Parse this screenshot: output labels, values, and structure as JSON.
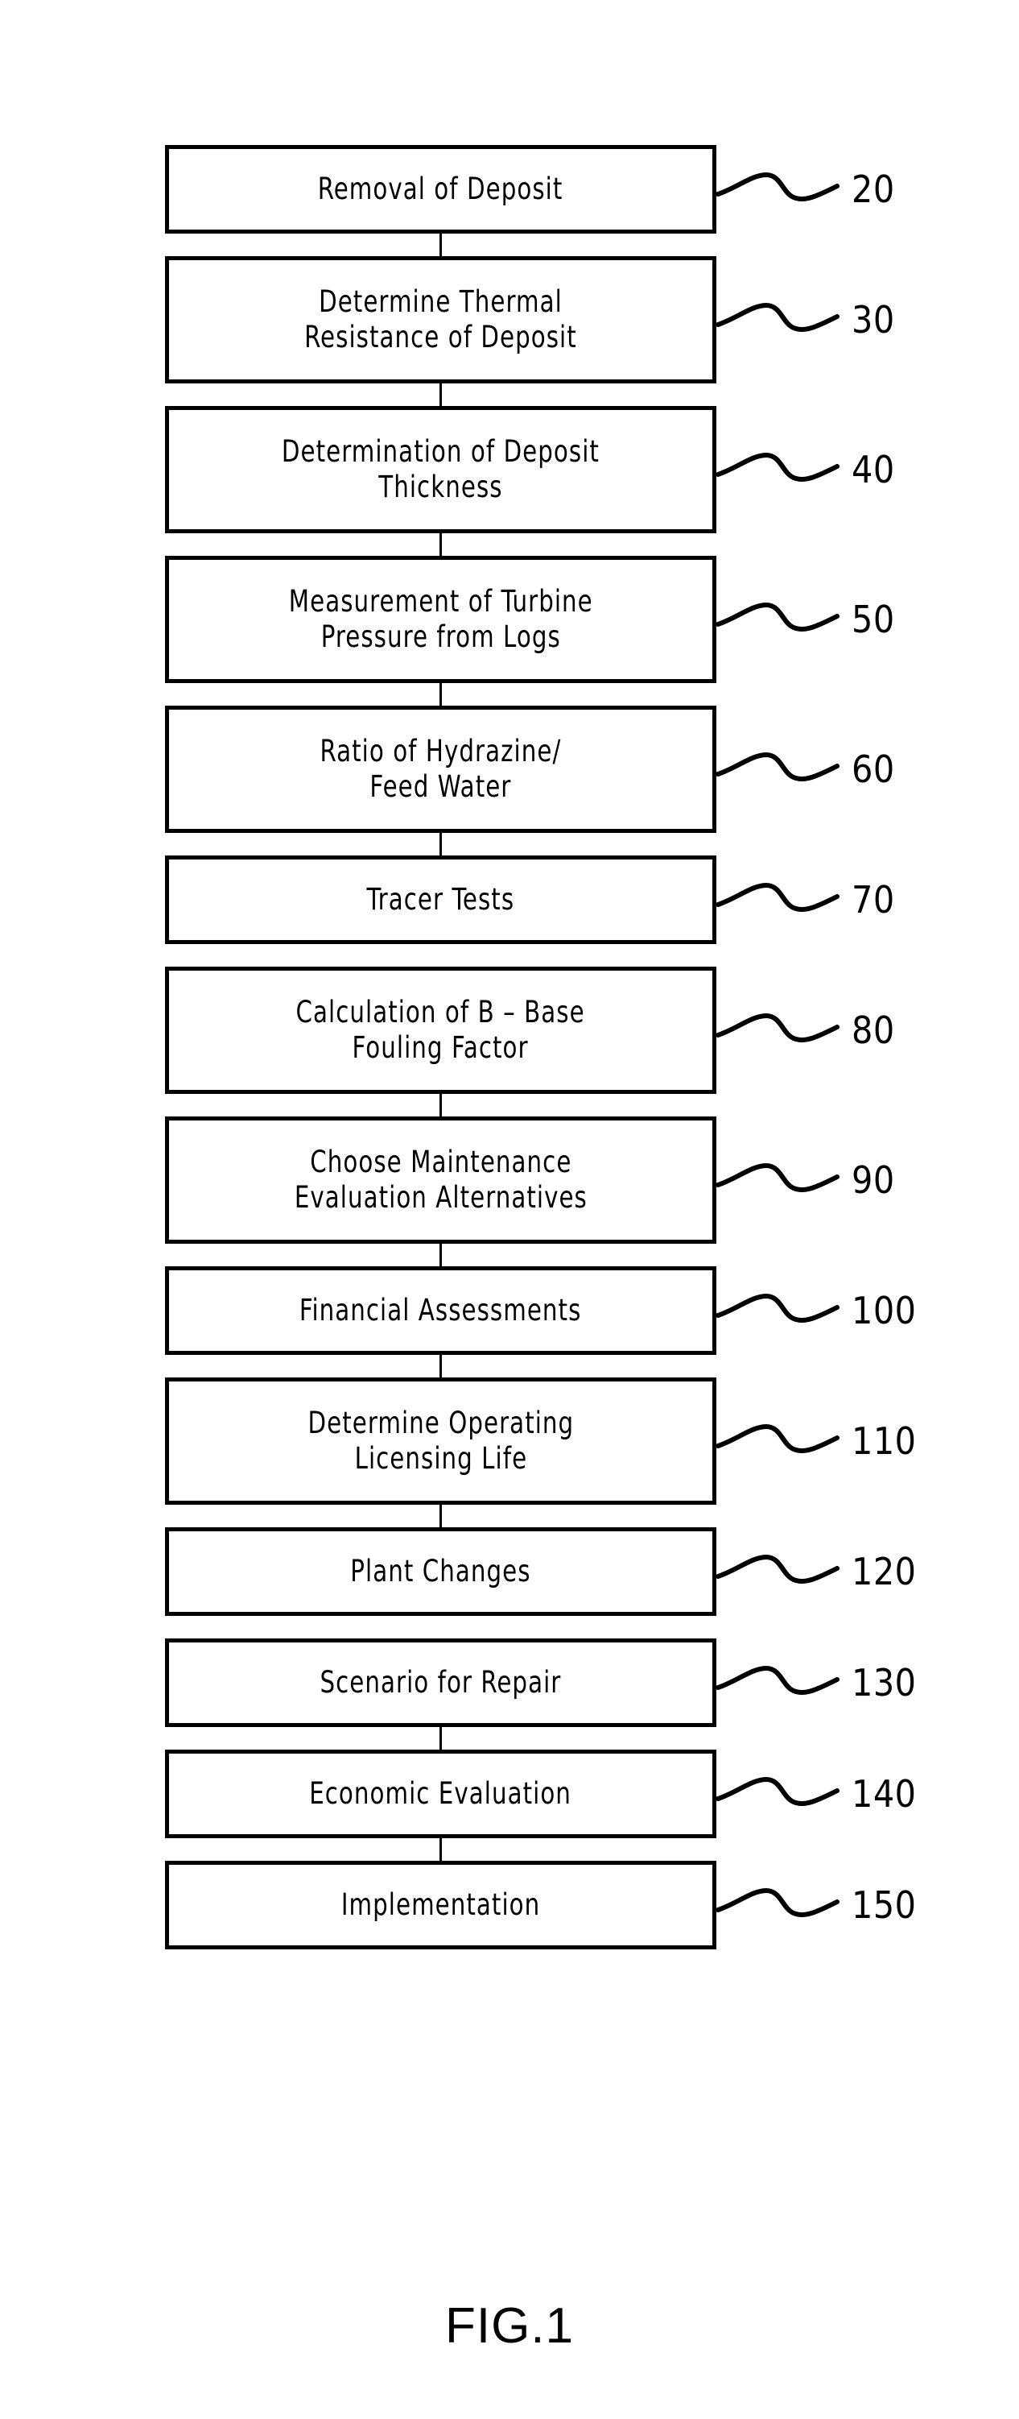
{
  "figure": {
    "caption": "FIG.1",
    "diagram_type": "flowchart",
    "orientation": "vertical",
    "line_color": "#000000",
    "background_color": "#ffffff"
  },
  "steps": [
    {
      "id": "step-removal-of-deposit",
      "ref": "20",
      "lines": [
        "Removal of Deposit"
      ],
      "height": "h1"
    },
    {
      "id": "step-determine-thermal-resistance",
      "ref": "30",
      "lines": [
        "Determine Thermal",
        "Resistance of Deposit"
      ],
      "height": "h2"
    },
    {
      "id": "step-determination-of-deposit-thickness",
      "ref": "40",
      "lines": [
        "Determination of Deposit",
        "Thickness"
      ],
      "height": "h2"
    },
    {
      "id": "step-measurement-of-turbine-pressure",
      "ref": "50",
      "lines": [
        "Measurement of Turbine",
        "Pressure from Logs"
      ],
      "height": "h2"
    },
    {
      "id": "step-ratio-of-hydrazine-feed-water",
      "ref": "60",
      "lines": [
        "Ratio of Hydrazine/",
        "Feed Water"
      ],
      "height": "h2"
    },
    {
      "id": "step-tracer-tests",
      "ref": "70",
      "lines": [
        "Tracer Tests"
      ],
      "height": "h1"
    },
    {
      "id": "step-calculation-of-base-fouling-factor",
      "ref": "80",
      "lines": [
        "Calculation of B – Base",
        "Fouling Factor"
      ],
      "height": "h2"
    },
    {
      "id": "step-choose-maintenance-alternatives",
      "ref": "90",
      "lines": [
        "Choose Maintenance",
        "Evaluation Alternatives"
      ],
      "height": "h2"
    },
    {
      "id": "step-financial-assessments",
      "ref": "100",
      "lines": [
        "Financial Assessments"
      ],
      "height": "h1"
    },
    {
      "id": "step-determine-operating-licensing-life",
      "ref": "110",
      "lines": [
        "Determine Operating",
        "Licensing Life"
      ],
      "height": "h2"
    },
    {
      "id": "step-plant-changes",
      "ref": "120",
      "lines": [
        "Plant Changes"
      ],
      "height": "h1"
    },
    {
      "id": "step-scenario-for-repair",
      "ref": "130",
      "lines": [
        "Scenario for Repair"
      ],
      "height": "h1"
    },
    {
      "id": "step-economic-evaluation",
      "ref": "140",
      "lines": [
        "Economic Evaluation"
      ],
      "height": "h1"
    },
    {
      "id": "step-implementation",
      "ref": "150",
      "lines": [
        "Implementation"
      ],
      "height": "h1"
    }
  ],
  "connectors": [
    {
      "from": "20",
      "to": "30",
      "visible": true
    },
    {
      "from": "30",
      "to": "40",
      "visible": true
    },
    {
      "from": "40",
      "to": "50",
      "visible": true
    },
    {
      "from": "50",
      "to": "60",
      "visible": true
    },
    {
      "from": "60",
      "to": "70",
      "visible": true
    },
    {
      "from": "70",
      "to": "80",
      "visible": false
    },
    {
      "from": "80",
      "to": "90",
      "visible": true
    },
    {
      "from": "90",
      "to": "100",
      "visible": true
    },
    {
      "from": "100",
      "to": "110",
      "visible": true
    },
    {
      "from": "110",
      "to": "120",
      "visible": true
    },
    {
      "from": "120",
      "to": "130",
      "visible": false
    },
    {
      "from": "130",
      "to": "140",
      "visible": true
    },
    {
      "from": "140",
      "to": "150",
      "visible": true
    }
  ]
}
